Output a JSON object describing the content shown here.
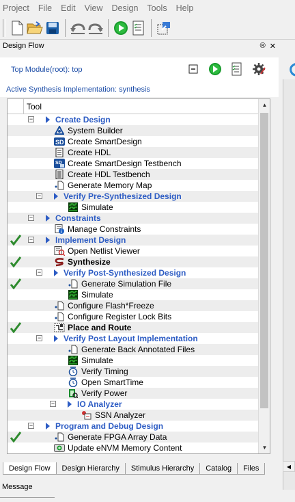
{
  "menu": [
    "Project",
    "File",
    "Edit",
    "View",
    "Design",
    "Tools",
    "Help"
  ],
  "panel": {
    "title": "Design Flow",
    "float_glyph": "®",
    "close_glyph": "✕"
  },
  "top_module": "Top Module(root): top",
  "active_impl": "Active Synthesis Implementation: synthesis",
  "tree": {
    "header": "Tool",
    "rows": [
      {
        "label": "Create Design",
        "indent": 1,
        "kind": "group",
        "expander": "−",
        "checked": false
      },
      {
        "label": "System Builder",
        "indent": 2,
        "kind": "item",
        "icon": "system-builder-icon",
        "checked": false
      },
      {
        "label": "Create SmartDesign",
        "indent": 2,
        "kind": "item",
        "icon": "smartdesign-icon",
        "checked": false
      },
      {
        "label": "Create HDL",
        "indent": 2,
        "kind": "item",
        "icon": "hdl-file-icon",
        "checked": false
      },
      {
        "label": "Create SmartDesign Testbench",
        "indent": 2,
        "kind": "item",
        "icon": "smartdesign-testbench-icon",
        "checked": false
      },
      {
        "label": "Create HDL Testbench",
        "indent": 2,
        "kind": "item",
        "icon": "hdl-testbench-icon",
        "checked": false
      },
      {
        "label": "Generate Memory Map",
        "indent": 2,
        "kind": "item",
        "icon": "generate-file-icon",
        "checked": false
      },
      {
        "label": "Verify Pre-Synthesized Design",
        "indent": 2,
        "kind": "group",
        "expander": "−",
        "checked": false
      },
      {
        "label": "Simulate",
        "indent": 3,
        "kind": "item",
        "icon": "simulate-icon",
        "checked": false
      },
      {
        "label": "Constraints",
        "indent": 1,
        "kind": "group",
        "expander": "−",
        "checked": false
      },
      {
        "label": "Manage Constraints",
        "indent": 2,
        "kind": "item",
        "icon": "constraints-icon",
        "checked": false
      },
      {
        "label": "Implement Design",
        "indent": 1,
        "kind": "group",
        "expander": "−",
        "checked": true
      },
      {
        "label": "Open Netlist Viewer",
        "indent": 2,
        "kind": "item",
        "icon": "netlist-viewer-icon",
        "checked": false
      },
      {
        "label": "Synthesize",
        "indent": 2,
        "kind": "bold",
        "icon": "synthesize-icon",
        "checked": true
      },
      {
        "label": "Verify Post-Synthesized Design",
        "indent": 2,
        "kind": "group",
        "expander": "−",
        "checked": false
      },
      {
        "label": "Generate Simulation File",
        "indent": 3,
        "kind": "item",
        "icon": "generate-file-icon",
        "checked": true
      },
      {
        "label": "Simulate",
        "indent": 3,
        "kind": "item",
        "icon": "simulate-icon",
        "checked": false
      },
      {
        "label": "Configure Flash*Freeze",
        "indent": 2,
        "kind": "item",
        "icon": "generate-file-icon",
        "checked": false
      },
      {
        "label": "Configure Register Lock Bits",
        "indent": 2,
        "kind": "item",
        "icon": "generate-file-icon",
        "checked": false
      },
      {
        "label": "Place and Route",
        "indent": 2,
        "kind": "bold",
        "icon": "place-route-icon",
        "checked": true
      },
      {
        "label": "Verify Post Layout Implementation",
        "indent": 2,
        "kind": "group",
        "expander": "−",
        "checked": false
      },
      {
        "label": "Generate Back Annotated Files",
        "indent": 3,
        "kind": "item",
        "icon": "generate-file-icon",
        "checked": false
      },
      {
        "label": "Simulate",
        "indent": 3,
        "kind": "item",
        "icon": "simulate-icon",
        "checked": false
      },
      {
        "label": "Verify Timing",
        "indent": 3,
        "kind": "item",
        "icon": "timing-icon",
        "checked": false
      },
      {
        "label": "Open SmartTime",
        "indent": 3,
        "kind": "item",
        "icon": "timing-icon",
        "checked": false
      },
      {
        "label": "Verify Power",
        "indent": 3,
        "kind": "item",
        "icon": "power-icon",
        "checked": false
      },
      {
        "label": "IO Analyzer",
        "indent": 3,
        "kind": "group",
        "expander": "−",
        "checked": false
      },
      {
        "label": "SSN Analyzer",
        "indent": 4,
        "kind": "item",
        "icon": "ssn-analyzer-icon",
        "checked": false
      },
      {
        "label": "Program and Debug Design",
        "indent": 1,
        "kind": "group",
        "expander": "−",
        "checked": false
      },
      {
        "label": "Generate FPGA Array Data",
        "indent": 2,
        "kind": "item",
        "icon": "generate-file-icon",
        "checked": true
      },
      {
        "label": "Update eNVM Memory Content",
        "indent": 2,
        "kind": "item",
        "icon": "envm-icon",
        "checked": false
      }
    ]
  },
  "tabs": [
    "Design Flow",
    "Design Hierarchy",
    "Stimulus Hierarchy",
    "Catalog",
    "Files"
  ],
  "active_tab": 0,
  "message_label": "Message",
  "colors": {
    "group_text": "#2d5cc4",
    "link_text": "#1f4fa8",
    "check": "#2e8b2e",
    "play": "#1a9c2e"
  }
}
